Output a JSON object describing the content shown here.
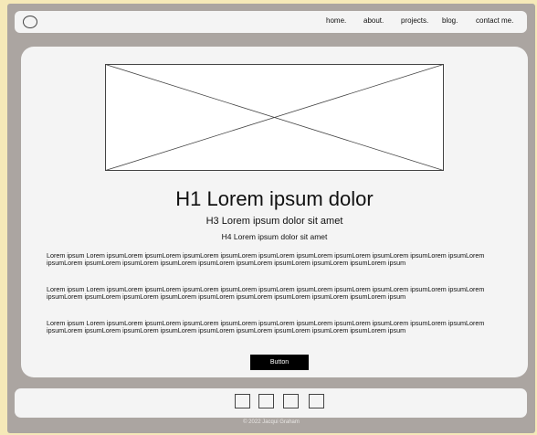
{
  "nav": {
    "links": [
      "home.",
      "about.",
      "projects.",
      "blog.",
      "contact me."
    ]
  },
  "main": {
    "hero_image": "image-placeholder-icon",
    "h1": "H1 Lorem ipsum dolor",
    "h3": "H3 Lorem ipsum dolor sit amet",
    "h4": "H4 Lorem ipsum dolor sit amet",
    "paragraphs": [
      "Lorem ipsum Lorem ipsumLorem ipsumLorem ipsumLorem ipsumLorem ipsumLorem ipsumLorem ipsumLorem ipsumLorem ipsumLorem ipsumLorem ipsumLorem ipsumLorem ipsumLorem ipsumLorem ipsumLorem ipsumLorem ipsumLorem ipsumLorem ipsumLorem ipsum",
      "Lorem ipsum Lorem ipsumLorem ipsumLorem ipsumLorem ipsumLorem ipsumLorem ipsumLorem ipsumLorem ipsumLorem ipsumLorem ipsumLorem ipsumLorem ipsumLorem ipsumLorem ipsumLorem ipsumLorem ipsumLorem ipsumLorem ipsumLorem ipsumLorem ipsum",
      "Lorem ipsum Lorem ipsumLorem ipsumLorem ipsumLorem ipsumLorem ipsumLorem ipsumLorem ipsumLorem ipsumLorem ipsumLorem ipsumLorem ipsumLorem ipsumLorem ipsumLorem ipsumLorem ipsumLorem ipsumLorem ipsumLorem ipsumLorem ipsumLorem ipsum"
    ],
    "button_label": "Button"
  },
  "footer": {
    "social_icons": [
      "social-icon-1",
      "social-icon-2",
      "social-icon-3",
      "social-icon-4"
    ],
    "copyright": "© 2022 Jacqui Graham"
  },
  "colors": {
    "page_background": "#f5e9b8",
    "frame": "#aba5a1",
    "panel": "#f4f4f4",
    "button": "#000000",
    "button_text": "#ffffff"
  }
}
